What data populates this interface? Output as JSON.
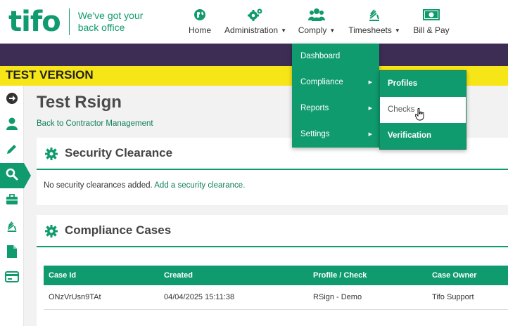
{
  "brand": {
    "logo_text": "tifo",
    "tagline_line1": "We've got your",
    "tagline_line2": "back office",
    "color": "#0f9b6e"
  },
  "nav": [
    {
      "label": "Home",
      "icon": "globe-icon"
    },
    {
      "label": "Administration",
      "icon": "gears-icon",
      "has_caret": true
    },
    {
      "label": "Comply",
      "icon": "users-icon",
      "has_caret": true
    },
    {
      "label": "Timesheets",
      "icon": "timesheet-icon",
      "has_caret": true
    },
    {
      "label": "Bill & Pay",
      "icon": "banknote-icon"
    }
  ],
  "banner": {
    "text": "TEST VERSION"
  },
  "sidebar": [
    {
      "icon": "arrow-right-circle-icon"
    },
    {
      "icon": "user-icon"
    },
    {
      "icon": "pencil-icon"
    },
    {
      "icon": "search-icon",
      "active": true
    },
    {
      "icon": "briefcase-icon"
    },
    {
      "icon": "timesheet-icon"
    },
    {
      "icon": "document-icon"
    },
    {
      "icon": "credit-card-icon"
    }
  ],
  "page": {
    "title": "Test Rsign",
    "back_link": "Back to Contractor Management"
  },
  "security": {
    "title": "Security Clearance",
    "empty_text": "No security clearances added.",
    "add_link": "Add a security clearance."
  },
  "compliance": {
    "title": "Compliance Cases",
    "columns": [
      "Case Id",
      "Created",
      "Profile / Check",
      "Case Owner"
    ],
    "rows": [
      {
        "case_id": "ONzVrUsn9TAt",
        "created": "04/04/2025 15:11:38",
        "profile": "RSign - Demo",
        "owner": "Tifo Support"
      }
    ]
  },
  "comply_menu": [
    {
      "label": "Dashboard"
    },
    {
      "label": "Compliance",
      "submenu": true
    },
    {
      "label": "Reports",
      "submenu": true
    },
    {
      "label": "Settings",
      "submenu": true
    }
  ],
  "compliance_submenu": [
    {
      "label": "Profiles"
    },
    {
      "label": "Checks",
      "hover": true
    },
    {
      "label": "Verification Modules"
    }
  ],
  "colors": {
    "accent": "#0f9b6e",
    "purple": "#3d2d55",
    "test_yellow": "#f7e617"
  }
}
